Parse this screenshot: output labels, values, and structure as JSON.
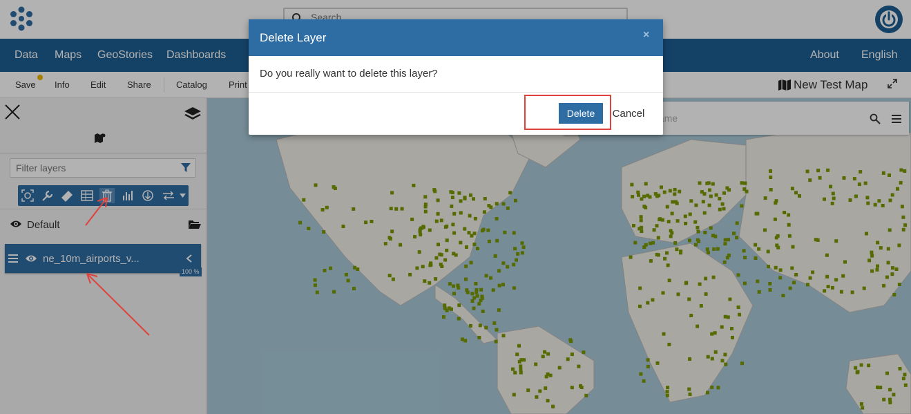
{
  "header": {
    "search_placeholder": "Search",
    "logo_icon": "geonode-logo-icon",
    "power_icon": "power-icon"
  },
  "nav": {
    "left": [
      "Data",
      "Maps",
      "GeoStories",
      "Dashboards"
    ],
    "right": [
      "About",
      "English"
    ]
  },
  "toolbar": {
    "items": [
      "Save",
      "Info",
      "Edit",
      "Share",
      "Catalog",
      "Print"
    ],
    "map_title": "New Test Map",
    "accent": "#f0b400"
  },
  "toc": {
    "filter_placeholder": "Filter layers",
    "group": "Default",
    "layer": "ne_10m_airports_v...",
    "opacity": "100 %"
  },
  "map": {
    "search_placeholder": "name",
    "point_color": "#7a9a01"
  },
  "modal": {
    "title": "Delete Layer",
    "close": "×",
    "message": "Do you really want to delete this layer?",
    "confirm": "Delete",
    "cancel": "Cancel"
  },
  "colors": {
    "primary": "#2e6da4",
    "nav": "#1e5f93",
    "highlight": "#e0413a"
  }
}
